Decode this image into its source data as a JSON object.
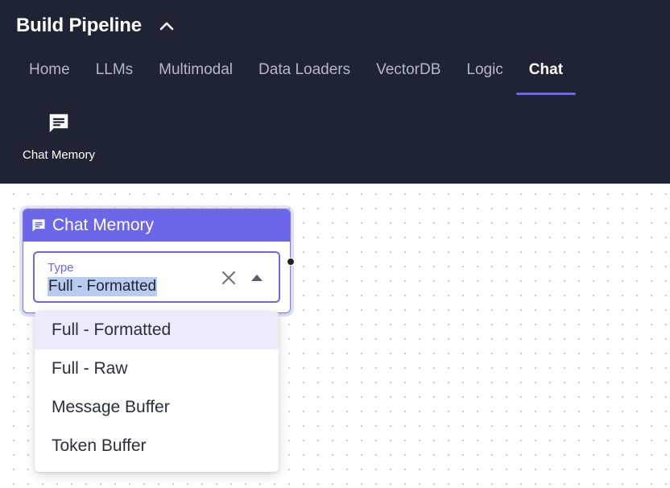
{
  "app": {
    "title": "Build Pipeline",
    "collapse_icon": "chevron-up-icon"
  },
  "tabs": [
    {
      "label": "Home",
      "active": false
    },
    {
      "label": "LLMs",
      "active": false
    },
    {
      "label": "Multimodal",
      "active": false
    },
    {
      "label": "Data Loaders",
      "active": false
    },
    {
      "label": "VectorDB",
      "active": false
    },
    {
      "label": "Logic",
      "active": false
    },
    {
      "label": "Chat",
      "active": true
    }
  ],
  "palette": {
    "items": [
      {
        "label": "Chat Memory",
        "icon": "chat-bubble-icon"
      }
    ]
  },
  "node": {
    "title": "Chat Memory",
    "icon": "chat-bubble-icon",
    "field": {
      "label": "Type",
      "value": "Full - Formatted",
      "clear_icon": "close-icon",
      "toggle_icon": "triangle-up-icon"
    },
    "options": [
      {
        "label": "Full - Formatted",
        "selected": true
      },
      {
        "label": "Full - Raw",
        "selected": false
      },
      {
        "label": "Message Buffer",
        "selected": false
      },
      {
        "label": "Token Buffer",
        "selected": false
      }
    ]
  },
  "colors": {
    "topbar": "#1e2433",
    "accent": "#6b67e8",
    "selection_highlight": "#b9cbee",
    "option_selected_bg": "#ecebfb"
  }
}
